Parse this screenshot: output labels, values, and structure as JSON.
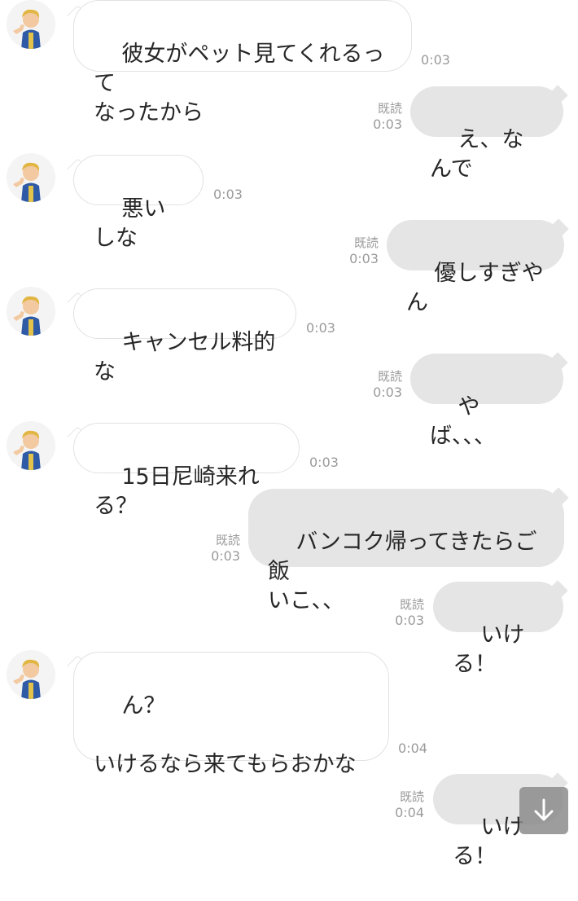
{
  "messages": [
    {
      "dir": "in",
      "text": "彼女がペット見てくれるって\nなったから",
      "time": "0:03"
    },
    {
      "dir": "out",
      "text": "え、なんで",
      "read": "既読",
      "time": "0:03"
    },
    {
      "dir": "in",
      "text": "悪いしな",
      "time": "0:03"
    },
    {
      "dir": "out",
      "text": "優しすぎやん",
      "read": "既読",
      "time": "0:03"
    },
    {
      "dir": "in",
      "text": "キャンセル料的な",
      "time": "0:03"
    },
    {
      "dir": "out",
      "text": "やば、、、",
      "read": "既読",
      "time": "0:03"
    },
    {
      "dir": "in",
      "text": "15日尼崎来れる？",
      "time": "0:03"
    },
    {
      "dir": "out",
      "text": "バンコク帰ってきたらご飯\nいこ、、",
      "read": "既読",
      "time": "0:03"
    },
    {
      "dir": "out",
      "text": "いける！",
      "read": "既読",
      "time": "0:03"
    },
    {
      "dir": "in",
      "text": "ん？\n\nいけるなら来てもらおかな",
      "time": "0:04"
    },
    {
      "dir": "out",
      "text": "いける！",
      "read": "既読",
      "time": "0:04"
    }
  ],
  "icons": {
    "avatar": "cartoon-thumbs-up-avatar",
    "scroll": "arrow-down-icon"
  },
  "colors": {
    "incoming_bubble": "#ffffff",
    "outgoing_bubble": "#e5e5e5",
    "meta_text": "#9a9a9a"
  }
}
